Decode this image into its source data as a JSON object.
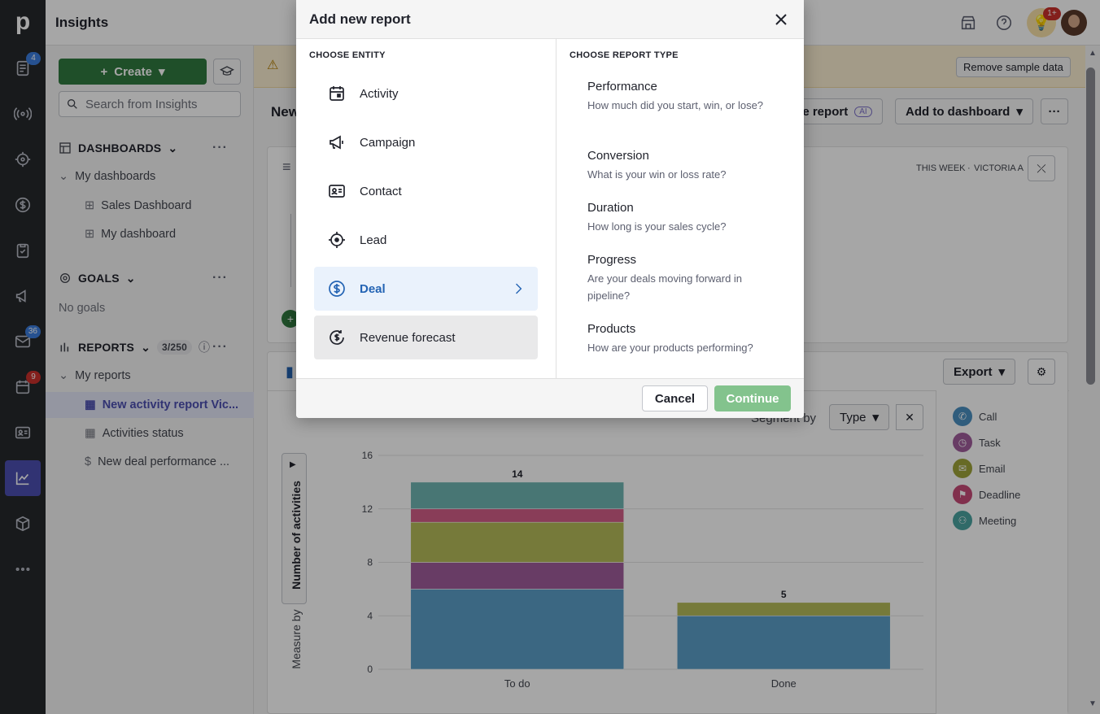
{
  "app": {
    "title": "Insights",
    "logo": "p"
  },
  "rail": {
    "items": [
      {
        "name": "deals-icon",
        "badge": "4"
      },
      {
        "name": "broadcast-icon",
        "badge": ""
      },
      {
        "name": "target-icon",
        "badge": ""
      },
      {
        "name": "dollar-icon",
        "badge": ""
      },
      {
        "name": "clipboard-icon",
        "badge": ""
      },
      {
        "name": "megaphone-icon",
        "badge": ""
      },
      {
        "name": "mail-icon",
        "badge": "36"
      },
      {
        "name": "calendar-icon",
        "badge": "9"
      },
      {
        "name": "contact-card-icon",
        "badge": ""
      },
      {
        "name": "insights-icon",
        "badge": ""
      },
      {
        "name": "box-icon",
        "badge": ""
      },
      {
        "name": "more-icon",
        "badge": ""
      }
    ]
  },
  "topbar": {
    "bulb_badge": "1+"
  },
  "sidebar": {
    "create_label": "Create",
    "search_placeholder": "Search from Insights",
    "dashboards": {
      "heading": "DASHBOARDS",
      "group": "My dashboards",
      "items": [
        "Sales Dashboard",
        "My dashboard"
      ]
    },
    "goals": {
      "heading": "GOALS",
      "empty": "No goals"
    },
    "reports": {
      "heading": "REPORTS",
      "count": "3/250",
      "group": "My reports",
      "items": [
        "New activity report Vic...",
        "Activities status",
        "New deal performance ..."
      ]
    }
  },
  "main": {
    "remove_sample": "Remove sample data",
    "title": "New",
    "create_report_partial": "ate report",
    "ai_badge": "AI",
    "add_to_dashboard": "Add to dashboard",
    "filter_period": "THIS WEEK",
    "filter_owner": "VICTORIA A",
    "export_label": "Export",
    "segment_by_label": "Segment by",
    "segment_value": "Type",
    "measure_by_label": "Measure by",
    "measure_value": "Number of activities"
  },
  "chart_data": {
    "type": "bar",
    "categories": [
      "To do",
      "Done"
    ],
    "series": [
      {
        "name": "Call",
        "color": "#5b9fc8",
        "values": [
          6,
          4
        ]
      },
      {
        "name": "Task",
        "color": "#a05c9c",
        "values": [
          2,
          0
        ]
      },
      {
        "name": "Email",
        "color": "#b6bc5a",
        "values": [
          3,
          1
        ]
      },
      {
        "name": "Deadline",
        "color": "#d35f88",
        "values": [
          1,
          0
        ]
      },
      {
        "name": "Meeting",
        "color": "#6fb5b3",
        "values": [
          2,
          0
        ]
      }
    ],
    "totals": [
      14,
      5
    ],
    "yticks": [
      0,
      4,
      8,
      12,
      16
    ],
    "ylim": [
      0,
      16
    ],
    "ylabel": "Number of activities"
  },
  "legend": [
    {
      "label": "Call",
      "color": "#4a8fc0",
      "icon": "phone-icon"
    },
    {
      "label": "Task",
      "color": "#a05c9c",
      "icon": "clock-icon"
    },
    {
      "label": "Email",
      "color": "#9ea43a",
      "icon": "envelope-icon"
    },
    {
      "label": "Deadline",
      "color": "#c74b77",
      "icon": "flag-icon"
    },
    {
      "label": "Meeting",
      "color": "#4aa3a0",
      "icon": "people-icon"
    }
  ],
  "modal": {
    "title": "Add new report",
    "entity_label": "CHOOSE ENTITY",
    "type_label": "CHOOSE REPORT TYPE",
    "entities": [
      "Activity",
      "Campaign",
      "Contact",
      "Lead",
      "Deal",
      "Revenue forecast"
    ],
    "report_types": [
      {
        "title": "Performance",
        "desc": "How much did you start, win, or lose?"
      },
      {
        "title": "Conversion",
        "desc": "What is your win or loss rate?"
      },
      {
        "title": "Duration",
        "desc": "How long is your sales cycle?"
      },
      {
        "title": "Progress",
        "desc": "Are your deals moving forward in pipeline?"
      },
      {
        "title": "Products",
        "desc": "How are your products performing?"
      }
    ],
    "cancel": "Cancel",
    "continue": "Continue"
  }
}
